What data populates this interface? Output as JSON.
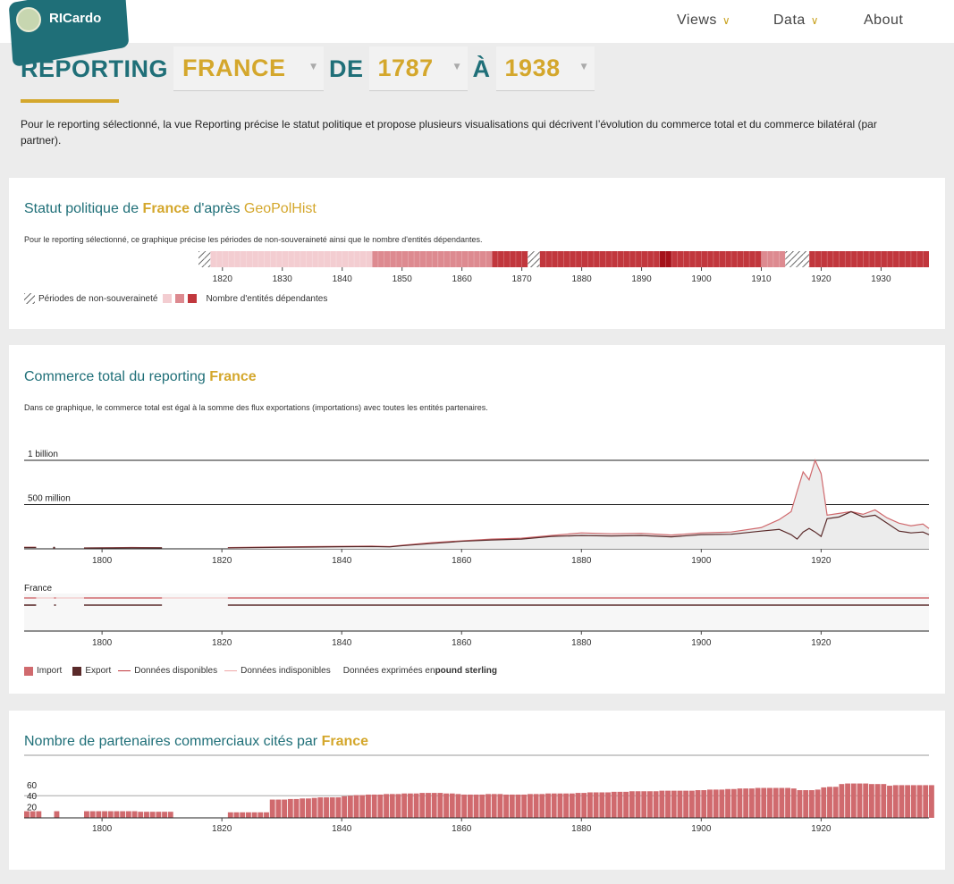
{
  "header": {
    "logo_text": "RICardo",
    "nav": [
      {
        "label": "Views",
        "has_dropdown": true
      },
      {
        "label": "Data",
        "has_dropdown": true
      },
      {
        "label": "About",
        "has_dropdown": false
      }
    ]
  },
  "title": {
    "prefix": "REPORTING",
    "reporting": "FRANCE",
    "from_label": "DE",
    "from_year": "1787",
    "to_label": "À",
    "to_year": "1938"
  },
  "intro": "Pour le reporting sélectionné, la vue Reporting précise le statut politique et propose plusieurs visualisations qui décrivent l’évolution du commerce total et du commerce bilatéral (par partner).",
  "status_card": {
    "title_a": "Statut politique de ",
    "title_reporting": "France",
    "title_b": " d'après ",
    "title_source": "GeoPolHist",
    "description": "Pour le reporting sélectionné, ce graphique précise les périodes de non-souveraineté ainsi que le nombre d'entités dépendantes.",
    "legend_nonsov": "Périodes de non-souveraineté",
    "legend_dependants": "Nombre d'entités dépendantes",
    "ticks": [
      "1820",
      "1830",
      "1840",
      "1850",
      "1860",
      "1870",
      "1880",
      "1890",
      "1900",
      "1910",
      "1920",
      "1930"
    ],
    "colors": {
      "light": "#f3cdd1",
      "mid": "#dd8a90",
      "dark": "#c1373d",
      "darkest": "#a5121a"
    }
  },
  "trade_card": {
    "title_a": "Commerce total du reporting ",
    "title_reporting": "France",
    "description": "Dans ce graphique, le commerce total est égal à la somme des flux exportations (importations) avec toutes les entités partenaires.",
    "y_labels": [
      "1 billion",
      "500 million"
    ],
    "ticks": [
      "1800",
      "1820",
      "1840",
      "1860",
      "1880",
      "1900",
      "1920"
    ],
    "availability_label": "France",
    "legend_import": "Import",
    "legend_export": "Export",
    "legend_available": "Données disponibles",
    "legend_unavailable": "Données indisponibles",
    "legend_currency_prefix": "Données exprimées en ",
    "legend_currency": "pound sterling",
    "colors": {
      "import": "#d06a6e",
      "export": "#5a2a2a"
    }
  },
  "partners_card": {
    "title_a": "Nombre de partenaires commerciaux cités par ",
    "title_reporting": "France",
    "y_labels": [
      "60",
      "40",
      "20"
    ],
    "ticks": [
      "1800",
      "1820",
      "1840",
      "1860",
      "1880",
      "1900",
      "1920"
    ],
    "color": "#d06a6e"
  },
  "chart_data": [
    {
      "type": "line",
      "title": "Commerce total du reporting France",
      "unit": "pound sterling",
      "ylim": [
        0,
        1200000000
      ],
      "series": [
        {
          "name": "Import",
          "x": [
            1787,
            1789,
            1792,
            1797,
            1805,
            1810,
            1821,
            1825,
            1830,
            1835,
            1840,
            1845,
            1848,
            1850,
            1855,
            1860,
            1865,
            1870,
            1875,
            1880,
            1885,
            1890,
            1895,
            1900,
            1905,
            1910,
            1913,
            1915,
            1916,
            1917,
            1918,
            1919,
            1920,
            1921,
            1923,
            1925,
            1927,
            1929,
            1931,
            1933,
            1935,
            1937,
            1938
          ],
          "values": [
            18000000,
            18000000,
            15000000,
            10000000,
            15000000,
            12000000,
            14000000,
            18000000,
            22000000,
            25000000,
            28000000,
            30000000,
            26000000,
            40000000,
            70000000,
            90000000,
            110000000,
            120000000,
            150000000,
            180000000,
            170000000,
            175000000,
            155000000,
            180000000,
            190000000,
            240000000,
            330000000,
            420000000,
            650000000,
            870000000,
            780000000,
            1000000000,
            850000000,
            380000000,
            400000000,
            420000000,
            390000000,
            440000000,
            350000000,
            290000000,
            260000000,
            280000000,
            230000000
          ]
        },
        {
          "name": "Export",
          "x": [
            1787,
            1789,
            1792,
            1797,
            1805,
            1810,
            1821,
            1825,
            1830,
            1835,
            1840,
            1845,
            1848,
            1850,
            1855,
            1860,
            1865,
            1870,
            1875,
            1880,
            1885,
            1890,
            1895,
            1900,
            1905,
            1910,
            1913,
            1915,
            1916,
            1917,
            1918,
            1919,
            1920,
            1921,
            1923,
            1925,
            1927,
            1929,
            1931,
            1933,
            1935,
            1937,
            1938
          ],
          "values": [
            15000000,
            15000000,
            12000000,
            9000000,
            12000000,
            11000000,
            10000000,
            14000000,
            18000000,
            20000000,
            24000000,
            26000000,
            22000000,
            35000000,
            60000000,
            85000000,
            100000000,
            110000000,
            140000000,
            150000000,
            145000000,
            150000000,
            135000000,
            160000000,
            165000000,
            200000000,
            220000000,
            160000000,
            110000000,
            190000000,
            230000000,
            190000000,
            140000000,
            340000000,
            360000000,
            420000000,
            360000000,
            380000000,
            290000000,
            200000000,
            180000000,
            190000000,
            160000000
          ]
        }
      ]
    },
    {
      "type": "bar",
      "title": "Nombre de partenaires commerciaux cités par France",
      "ylim": [
        0,
        70
      ],
      "x": [
        1787,
        1788,
        1789,
        1792,
        1797,
        1798,
        1799,
        1800,
        1801,
        1802,
        1803,
        1804,
        1805,
        1806,
        1807,
        1808,
        1809,
        1810,
        1811,
        1821,
        1822,
        1823,
        1824,
        1825,
        1826,
        1827,
        1828,
        1829,
        1830,
        1831,
        1832,
        1833,
        1834,
        1835,
        1836,
        1837,
        1838,
        1839,
        1840,
        1841,
        1842,
        1843,
        1844,
        1845,
        1846,
        1847,
        1848,
        1849,
        1850,
        1851,
        1852,
        1853,
        1854,
        1855,
        1856,
        1857,
        1858,
        1859,
        1860,
        1861,
        1862,
        1863,
        1864,
        1865,
        1866,
        1867,
        1868,
        1869,
        1870,
        1871,
        1872,
        1873,
        1874,
        1875,
        1876,
        1877,
        1878,
        1879,
        1880,
        1881,
        1882,
        1883,
        1884,
        1885,
        1886,
        1887,
        1888,
        1889,
        1890,
        1891,
        1892,
        1893,
        1894,
        1895,
        1896,
        1897,
        1898,
        1899,
        1900,
        1901,
        1902,
        1903,
        1904,
        1905,
        1906,
        1907,
        1908,
        1909,
        1910,
        1911,
        1912,
        1913,
        1914,
        1915,
        1916,
        1917,
        1918,
        1919,
        1920,
        1921,
        1922,
        1923,
        1924,
        1925,
        1926,
        1927,
        1928,
        1929,
        1930,
        1931,
        1932,
        1933,
        1934,
        1935,
        1936,
        1937,
        1938
      ],
      "values": [
        12,
        12,
        12,
        12,
        12,
        12,
        12,
        12,
        12,
        12,
        12,
        12,
        12,
        11,
        11,
        11,
        11,
        11,
        11,
        10,
        10,
        10,
        10,
        10,
        10,
        10,
        33,
        33,
        33,
        34,
        34,
        35,
        35,
        36,
        37,
        37,
        37,
        37,
        39,
        40,
        41,
        41,
        42,
        42,
        42,
        43,
        43,
        43,
        44,
        44,
        44,
        45,
        45,
        45,
        45,
        44,
        44,
        43,
        42,
        42,
        42,
        42,
        43,
        43,
        43,
        42,
        42,
        42,
        42,
        43,
        43,
        43,
        44,
        44,
        44,
        44,
        44,
        45,
        45,
        46,
        46,
        46,
        46,
        47,
        47,
        47,
        48,
        48,
        48,
        48,
        48,
        49,
        49,
        49,
        49,
        49,
        49,
        50,
        50,
        51,
        51,
        51,
        52,
        52,
        53,
        53,
        53,
        54,
        54,
        54,
        54,
        54,
        54,
        53,
        50,
        50,
        50,
        51,
        55,
        56,
        56,
        61,
        62,
        62,
        62,
        62,
        61,
        61,
        61,
        58,
        59,
        59,
        59,
        59,
        59,
        59,
        59
      ]
    }
  ]
}
